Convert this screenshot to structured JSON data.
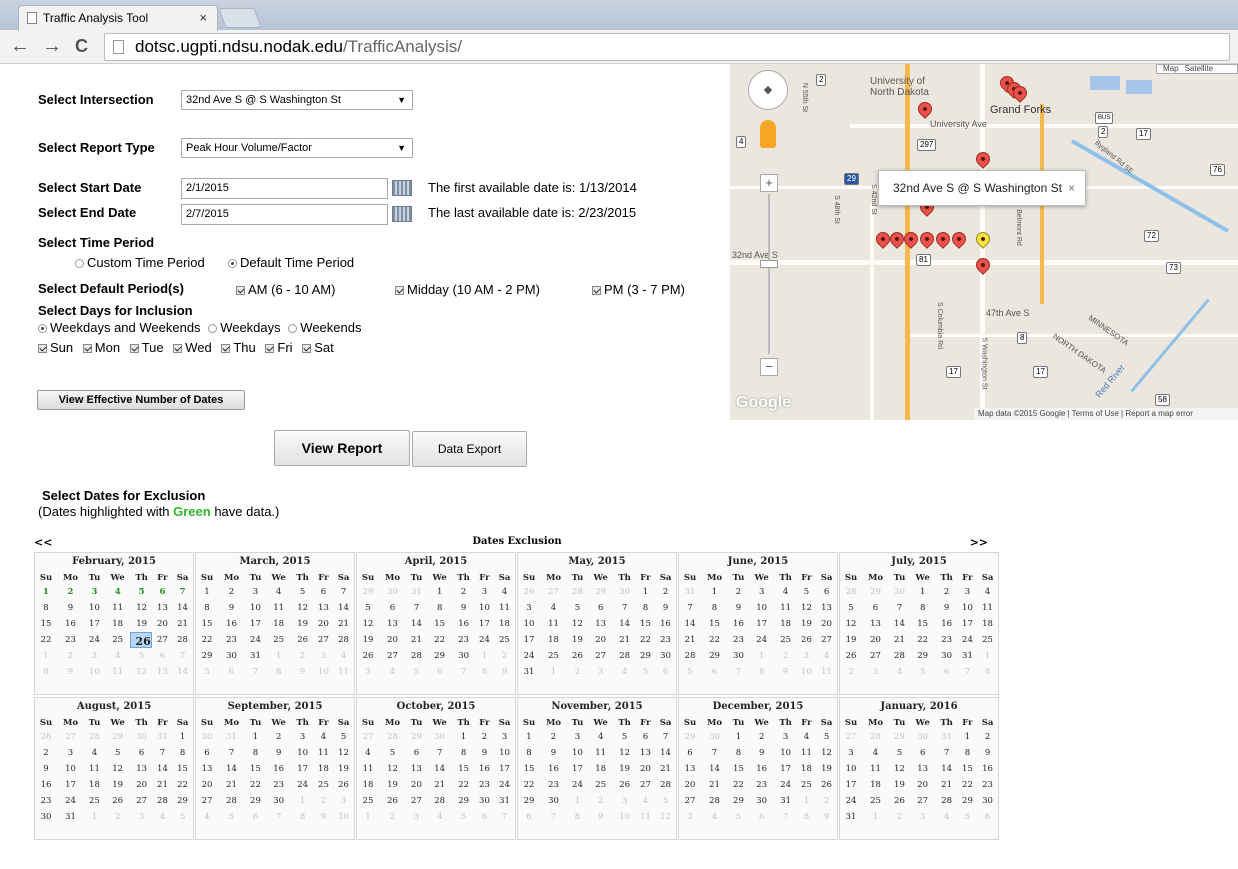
{
  "browser": {
    "tab_title": "Traffic Analysis Tool",
    "tab_close": "×",
    "url_domain": "dotsc.ugpti.ndsu.nodak.edu",
    "url_path": "/TrafficAnalysis/",
    "back": "←",
    "forward": "→",
    "reload": "C"
  },
  "form": {
    "intersection_label": "Select Intersection",
    "intersection_value": "32nd Ave S @ S Washington St",
    "report_type_label": "Select Report Type",
    "report_type_value": "Peak Hour Volume/Factor",
    "start_label": "Select Start Date",
    "start_value": "2/1/2015",
    "start_note": "The first available date is: 1/13/2014",
    "end_label": "Select End Date",
    "end_value": "2/7/2015",
    "end_note": "The last available date is: 2/23/2015",
    "time_period_label": "Select Time Period",
    "custom_period": "Custom Time Period",
    "default_period": "Default Time Period",
    "default_periods_label": "Select Default Period(s)",
    "period_am": "AM (6 - 10 AM)",
    "period_midday": "Midday (10 AM - 2 PM)",
    "period_pm": "PM (3 - 7 PM)",
    "days_label": "Select Days for Inclusion",
    "days_opt1": "Weekdays and Weekends",
    "days_opt2": "Weekdays",
    "days_opt3": "Weekends",
    "day_sun": "Sun",
    "day_mon": "Mon",
    "day_tue": "Tue",
    "day_wed": "Wed",
    "day_thu": "Thu",
    "day_fri": "Fri",
    "day_sat": "Sat",
    "effective_btn": "View Effective Number of Dates",
    "view_report_btn": "View Report",
    "data_export_btn": "Data Export",
    "exclusion_title": "Select Dates for Exclusion",
    "exclusion_note_pre": "(Dates highlighted with ",
    "exclusion_note_green": "Green",
    "exclusion_note_post": " have data.)"
  },
  "map": {
    "popup_text": "32nd Ave S @ S Washington St",
    "popup_close": "×",
    "footer": "Map data ©2015 Google | Terms of Use | Report a map error",
    "google": "Google",
    "type_map": "Map",
    "type_sat": "Satellite",
    "labels": {
      "university": "University of North Dakota",
      "grand_forks": "Grand Forks",
      "university_ave": "University Ave",
      "ave32": "32nd Ave S",
      "ave47": "47th Ave S",
      "minnesota": "MINNESOTA",
      "north_dakota": "NORTH DAKOTA",
      "red_river": "Red River",
      "s55": "N 55th St",
      "s42": "S 42nd St",
      "s48": "S 48th St",
      "columbia": "S Columbia Rd",
      "washington": "S Washington St",
      "belmont": "Belmont Rd",
      "bygland": "Bygland Rd SE"
    },
    "shields": [
      "2",
      "4",
      "297",
      "29",
      "81",
      "17",
      "76",
      "72",
      "73",
      "8",
      "17",
      "17",
      "58",
      "2",
      "BUS"
    ]
  },
  "calendar": {
    "header": "Dates Exclusion",
    "prev": "<<",
    "next": ">>",
    "weekdays": [
      "Su",
      "Mo",
      "Tu",
      "We",
      "Th",
      "Fr",
      "Sa"
    ],
    "months": [
      {
        "title": "February, 2015",
        "lead": [],
        "days": 28,
        "trail": 14,
        "green": [
          1,
          2,
          3,
          4,
          5,
          6,
          7
        ],
        "selected": 26
      },
      {
        "title": "March, 2015",
        "lead": [],
        "days": 31,
        "trail": 11
      },
      {
        "title": "April, 2015",
        "lead": [
          29,
          30,
          31
        ],
        "days": 30,
        "trail": 9
      },
      {
        "title": "May, 2015",
        "lead": [
          26,
          27,
          28,
          29,
          30
        ],
        "days": 31,
        "trail": 6
      },
      {
        "title": "June, 2015",
        "lead": [
          31
        ],
        "days": 30,
        "trail": 11
      },
      {
        "title": "July, 2015",
        "lead": [
          28,
          29,
          30
        ],
        "days": 31,
        "trail": 8
      },
      {
        "title": "August, 2015",
        "lead": [
          26,
          27,
          28,
          29,
          30,
          31
        ],
        "days": 31,
        "trail": 5
      },
      {
        "title": "September, 2015",
        "lead": [
          30,
          31
        ],
        "days": 30,
        "trail": 10
      },
      {
        "title": "October, 2015",
        "lead": [
          27,
          28,
          29,
          30
        ],
        "days": 31,
        "trail": 7
      },
      {
        "title": "November, 2015",
        "lead": [],
        "days": 30,
        "trail": 12
      },
      {
        "title": "December, 2015",
        "lead": [
          29,
          30
        ],
        "days": 31,
        "trail": 9
      },
      {
        "title": "January, 2016",
        "lead": [
          27,
          28,
          29,
          30,
          31
        ],
        "days": 31,
        "trail": 6
      }
    ]
  }
}
